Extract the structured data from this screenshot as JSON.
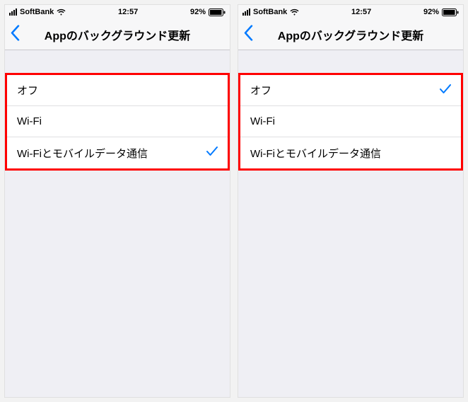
{
  "phones": [
    {
      "status": {
        "carrier": "SoftBank",
        "time": "12:57",
        "battery_pct": "92%"
      },
      "nav": {
        "title": "Appのバックグラウンド更新"
      },
      "options": [
        {
          "label": "オフ",
          "checked": false
        },
        {
          "label": "Wi-Fi",
          "checked": false
        },
        {
          "label": "Wi-Fiとモバイルデータ通信",
          "checked": true
        }
      ]
    },
    {
      "status": {
        "carrier": "SoftBank",
        "time": "12:57",
        "battery_pct": "92%"
      },
      "nav": {
        "title": "Appのバックグラウンド更新"
      },
      "options": [
        {
          "label": "オフ",
          "checked": true
        },
        {
          "label": "Wi-Fi",
          "checked": false
        },
        {
          "label": "Wi-Fiとモバイルデータ通信",
          "checked": false
        }
      ]
    }
  ]
}
